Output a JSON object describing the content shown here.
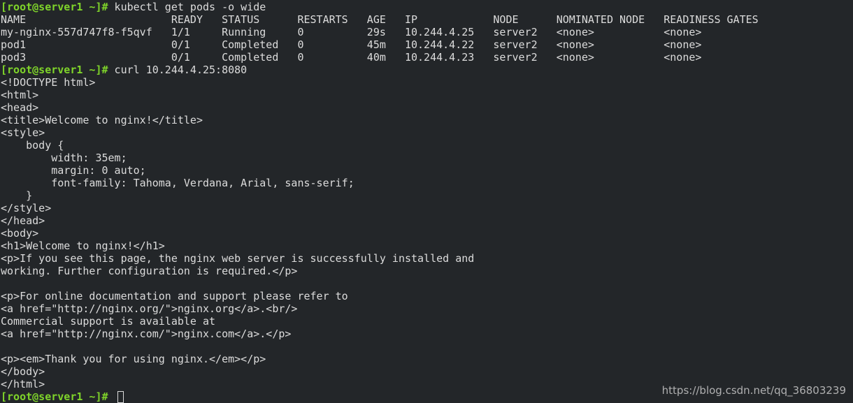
{
  "terminal": {
    "prompt": "[root@server1 ~]#",
    "lines": [
      {
        "prompt": true,
        "text": " kubectl get pods -o wide"
      },
      {
        "text": "NAME                       READY   STATUS      RESTARTS   AGE   IP            NODE      NOMINATED NODE   READINESS GATES"
      },
      {
        "text": "my-nginx-557d747f8-f5qvf   1/1     Running     0          29s   10.244.4.25   server2   <none>           <none>"
      },
      {
        "text": "pod1                       0/1     Completed   0          45m   10.244.4.22   server2   <none>           <none>"
      },
      {
        "text": "pod3                       0/1     Completed   0          40m   10.244.4.23   server2   <none>           <none>"
      },
      {
        "prompt": true,
        "text": " curl 10.244.4.25:8080"
      },
      {
        "text": "<!DOCTYPE html>"
      },
      {
        "text": "<html>"
      },
      {
        "text": "<head>"
      },
      {
        "text": "<title>Welcome to nginx!</title>"
      },
      {
        "text": "<style>"
      },
      {
        "text": "    body {"
      },
      {
        "text": "        width: 35em;"
      },
      {
        "text": "        margin: 0 auto;"
      },
      {
        "text": "        font-family: Tahoma, Verdana, Arial, sans-serif;"
      },
      {
        "text": "    }"
      },
      {
        "text": "</style>"
      },
      {
        "text": "</head>"
      },
      {
        "text": "<body>"
      },
      {
        "text": "<h1>Welcome to nginx!</h1>"
      },
      {
        "text": "<p>If you see this page, the nginx web server is successfully installed and"
      },
      {
        "text": "working. Further configuration is required.</p>"
      },
      {
        "text": ""
      },
      {
        "text": "<p>For online documentation and support please refer to"
      },
      {
        "text": "<a href=\"http://nginx.org/\">nginx.org</a>.<br/>"
      },
      {
        "text": "Commercial support is available at"
      },
      {
        "text": "<a href=\"http://nginx.com/\">nginx.com</a>.</p>"
      },
      {
        "text": ""
      },
      {
        "text": "<p><em>Thank you for using nginx.</em></p>"
      },
      {
        "text": "</body>"
      },
      {
        "text": "</html>"
      },
      {
        "prompt": true,
        "text": " ",
        "cursor": true
      }
    ]
  },
  "watermark": "https://blog.csdn.net/qq_36803239",
  "colors": {
    "background": "#232629",
    "prompt": "#7fd42a",
    "text": "#dcdcdc"
  }
}
